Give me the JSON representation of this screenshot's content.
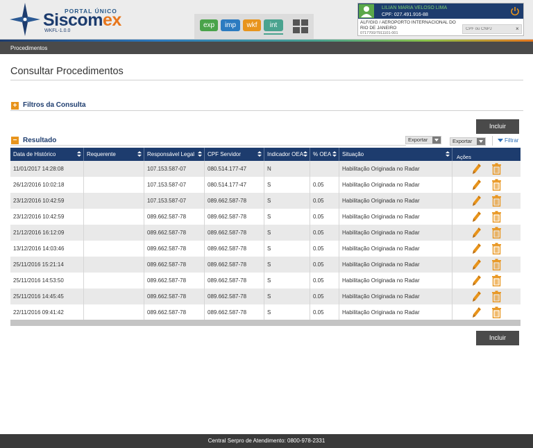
{
  "header": {
    "portal": "PORTAL ÚNICO",
    "brand_main": "Siscom",
    "brand_accent": "ex",
    "version": "WKFL-1.0.0",
    "modules": [
      {
        "label": "exp",
        "color": "#4aa34a"
      },
      {
        "label": "imp",
        "color": "#2c7bc0"
      },
      {
        "label": "wkf",
        "color": "#e8941c"
      },
      {
        "label": "int",
        "color": "#4aa38f"
      }
    ],
    "user": {
      "name": "LILIAN MARIA VELOSO LIMA",
      "cpf": "CPF: 027.491.916-88",
      "org": "ALF/GIG / AEROPORTO INTERNACIONAL DO RIO DE JANEIRO",
      "code": "0717700/7911101-001",
      "cpf_placeholder": "CPF ou CNPJ",
      "close": "×"
    }
  },
  "breadcrumb": "Procedimentos",
  "page_title": "Consultar Procedimentos",
  "filters": {
    "title": "Filtros da Consulta",
    "icon": "+"
  },
  "result": {
    "title": "Resultado",
    "icon": "−"
  },
  "actions": {
    "incluir_top": "Incluir",
    "incluir_bottom": "Incluir",
    "exportar_1": "Exportar",
    "exportar_2": "Exportar",
    "filtrar": "Filtrar"
  },
  "table": {
    "columns": [
      "Data de Histórico",
      "Requerente",
      "Responsável Legal",
      "CPF Servidor",
      "Indicador OEA",
      "% OEA",
      "Situação",
      "Ações"
    ],
    "rows": [
      [
        "11/01/2017 14:28:08",
        "",
        "107.153.587-07",
        "080.514.177-47",
        "N",
        "",
        "Habilitação Originada no Radar"
      ],
      [
        "26/12/2016 10:02:18",
        "",
        "107.153.587-07",
        "080.514.177-47",
        "S",
        "0.05",
        "Habilitação Originada no Radar"
      ],
      [
        "23/12/2016 10:42:59",
        "",
        "107.153.587-07",
        "089.662.587-78",
        "S",
        "0.05",
        "Habilitação Originada no Radar"
      ],
      [
        "23/12/2016 10:42:59",
        "",
        "089.662.587-78",
        "089.662.587-78",
        "S",
        "0.05",
        "Habilitação Originada no Radar"
      ],
      [
        "21/12/2016 16:12:09",
        "",
        "089.662.587-78",
        "089.662.587-78",
        "S",
        "0.05",
        "Habilitação Originada no Radar"
      ],
      [
        "13/12/2016 14:03:46",
        "",
        "089.662.587-78",
        "089.662.587-78",
        "S",
        "0.05",
        "Habilitação Originada no Radar"
      ],
      [
        "25/11/2016 15:21:14",
        "",
        "089.662.587-78",
        "089.662.587-78",
        "S",
        "0.05",
        "Habilitação Originada no Radar"
      ],
      [
        "25/11/2016 14:53:50",
        "",
        "089.662.587-78",
        "089.662.587-78",
        "S",
        "0.05",
        "Habilitação Originada no Radar"
      ],
      [
        "25/11/2016 14:45:45",
        "",
        "089.662.587-78",
        "089.662.587-78",
        "S",
        "0.05",
        "Habilitação Originada no Radar"
      ],
      [
        "22/11/2016 09:41:42",
        "",
        "089.662.587-78",
        "089.662.587-78",
        "S",
        "0.05",
        "Habilitação Originada no Radar"
      ]
    ]
  },
  "footer": "Central Serpro de Atendimento: 0800-978-2331",
  "colors": {
    "primary": "#1d3c6e",
    "accent": "#e8941c",
    "dark": "#4a4a4a"
  }
}
